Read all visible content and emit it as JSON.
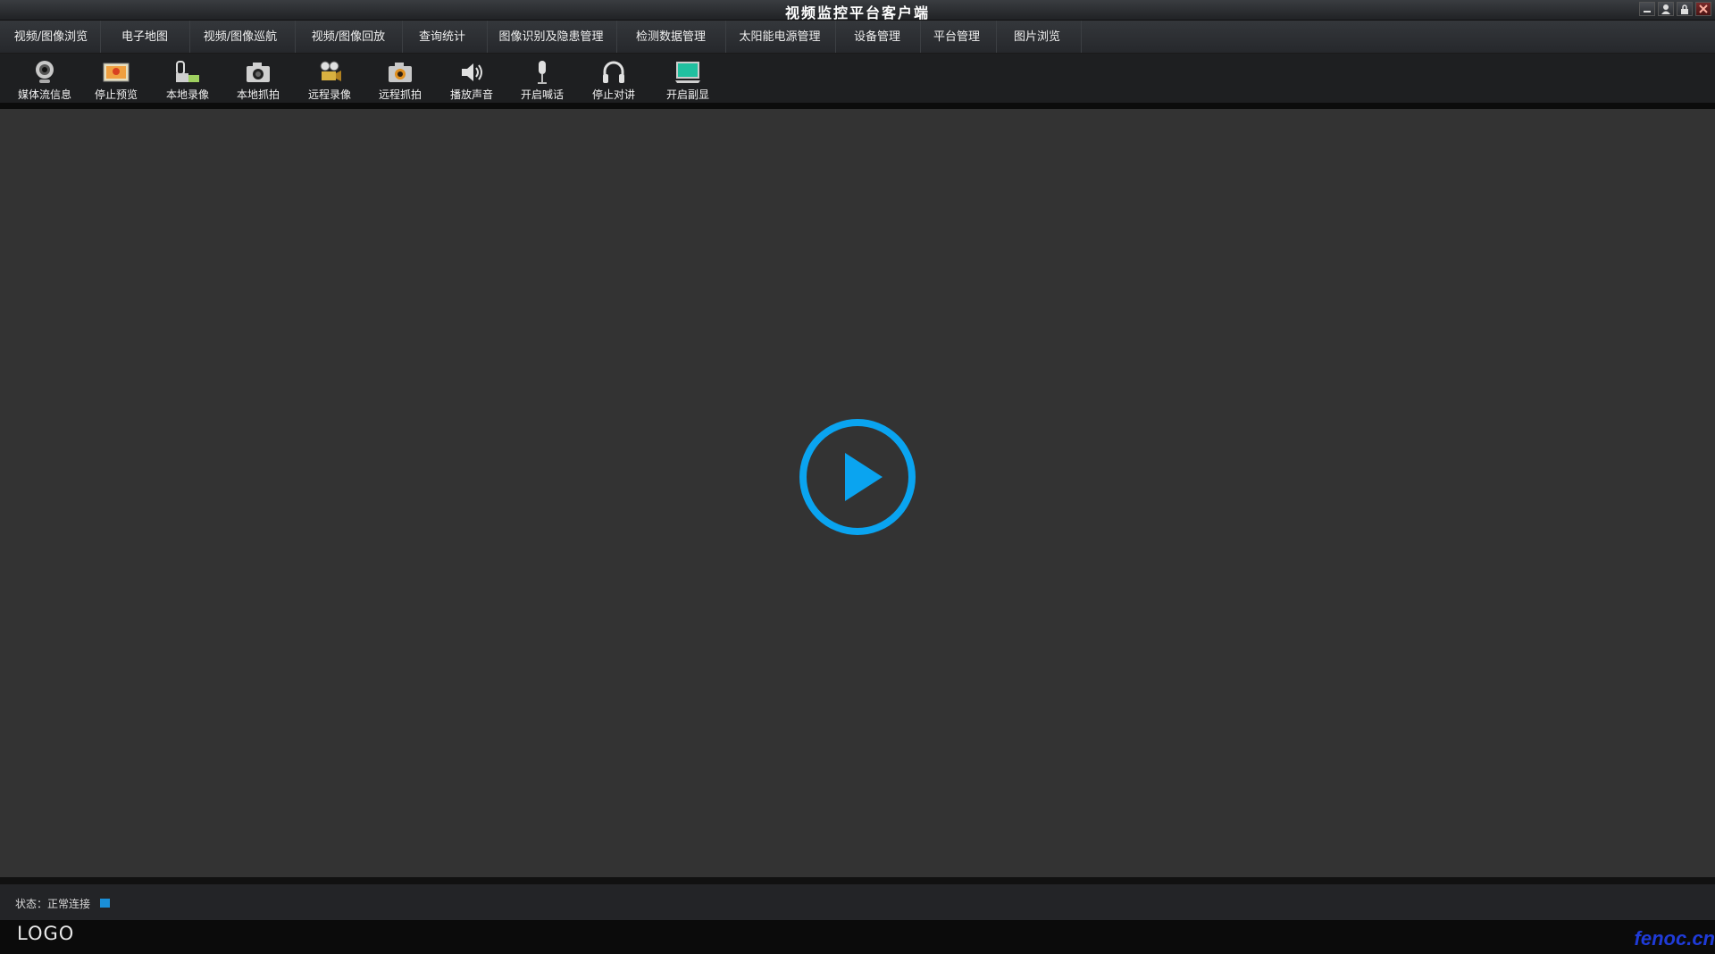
{
  "window": {
    "title": "视频监控平台客户端"
  },
  "menu": [
    {
      "label": "视频/图像浏览"
    },
    {
      "label": "电子地图"
    },
    {
      "label": "视频/图像巡航"
    },
    {
      "label": "视频/图像回放"
    },
    {
      "label": "查询统计"
    },
    {
      "label": "图像识别及隐患管理"
    },
    {
      "label": "检测数据管理"
    },
    {
      "label": "太阳能电源管理"
    },
    {
      "label": "设备管理"
    },
    {
      "label": "平台管理"
    },
    {
      "label": "图片浏览"
    }
  ],
  "toolbar": [
    {
      "label": "媒体流信息",
      "icon": "webcam-icon"
    },
    {
      "label": "停止预览",
      "icon": "picture-icon"
    },
    {
      "label": "本地录像",
      "icon": "camcorder-icon"
    },
    {
      "label": "本地抓拍",
      "icon": "camera-icon"
    },
    {
      "label": "远程录像",
      "icon": "film-camera-icon"
    },
    {
      "label": "远程抓拍",
      "icon": "remote-camera-icon"
    },
    {
      "label": "播放声音",
      "icon": "speaker-icon"
    },
    {
      "label": "开启喊话",
      "icon": "microphone-icon"
    },
    {
      "label": "停止对讲",
      "icon": "headset-icon"
    },
    {
      "label": "开启副显",
      "icon": "monitor-icon"
    }
  ],
  "status": {
    "label": "状态：正常连接",
    "indicator_color": "#1a8fd8"
  },
  "footer": {
    "logo": "LOGO",
    "watermark": "fenoc.cn"
  },
  "colors": {
    "accent": "#0aa4f0",
    "background": "#333333"
  }
}
